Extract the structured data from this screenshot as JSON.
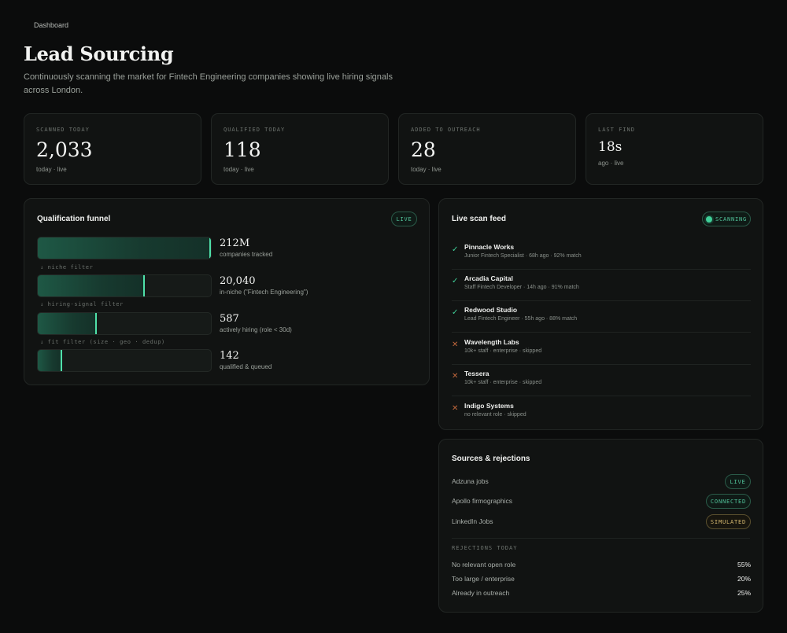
{
  "breadcrumb": "Dashboard",
  "title": "Lead Sourcing",
  "subtitle": "Continuously scanning the market for Fintech Engineering companies showing live hiring signals across London.",
  "stats": [
    {
      "label": "SCANNED TODAY",
      "value": "2,033",
      "sub": "today · live"
    },
    {
      "label": "QUALIFIED TODAY",
      "value": "118",
      "sub": "today · live"
    },
    {
      "label": "ADDED TO OUTREACH",
      "value": "28",
      "sub": "today · live"
    },
    {
      "label": "LAST FIND",
      "value": "18s",
      "sub": "ago · live"
    }
  ],
  "funnel": {
    "title": "Qualification funnel",
    "badge": "LIVE",
    "stages": [
      {
        "value": "212M",
        "label": "companies tracked",
        "fill": 1.0
      },
      {
        "value": "20,040",
        "label": "in-niche (\"Fintech Engineering\")",
        "fill": 0.62
      },
      {
        "value": "587",
        "label": "actively hiring (role < 30d)",
        "fill": 0.34
      },
      {
        "value": "142",
        "label": "qualified & queued",
        "fill": 0.14
      }
    ],
    "filters": [
      "↓ niche filter",
      "↓ hiring-signal filter",
      "↓ fit filter (size · geo · dedup)"
    ]
  },
  "feed": {
    "title": "Live scan feed",
    "badge": "SCANNING",
    "items": [
      {
        "status": "ok",
        "name": "Pinnacle Works",
        "meta": "Junior Fintech Specialist · 68h ago · 92% match"
      },
      {
        "status": "ok",
        "name": "Arcadia Capital",
        "meta": "Staff Fintech Developer · 14h ago · 91% match"
      },
      {
        "status": "ok",
        "name": "Redwood Studio",
        "meta": "Lead Fintech Engineer · 55h ago · 88% match"
      },
      {
        "status": "no",
        "name": "Wavelength Labs",
        "meta": "10k+ staff · enterprise · skipped"
      },
      {
        "status": "no",
        "name": "Tessera",
        "meta": "10k+ staff · enterprise · skipped"
      },
      {
        "status": "no",
        "name": "Indigo Systems",
        "meta": "no relevant role · skipped"
      }
    ]
  },
  "sources": {
    "title": "Sources & rejections",
    "items": [
      {
        "name": "Adzuna jobs",
        "badge": "LIVE",
        "tone": "green"
      },
      {
        "name": "Apollo firmographics",
        "badge": "CONNECTED",
        "tone": "green"
      },
      {
        "name": "LinkedIn Jobs",
        "badge": "SIMULATED",
        "tone": "amber"
      }
    ],
    "rejections_heading": "REJECTIONS TODAY",
    "rejections": [
      {
        "name": "No relevant open role",
        "value": "55%"
      },
      {
        "name": "Too large / enterprise",
        "value": "20%"
      },
      {
        "name": "Already in outreach",
        "value": "25%"
      }
    ]
  },
  "colors": {
    "accent": "#3fcf98",
    "reject": "#c0673c",
    "amber": "#d6b970",
    "background": "#0b0c0c"
  }
}
